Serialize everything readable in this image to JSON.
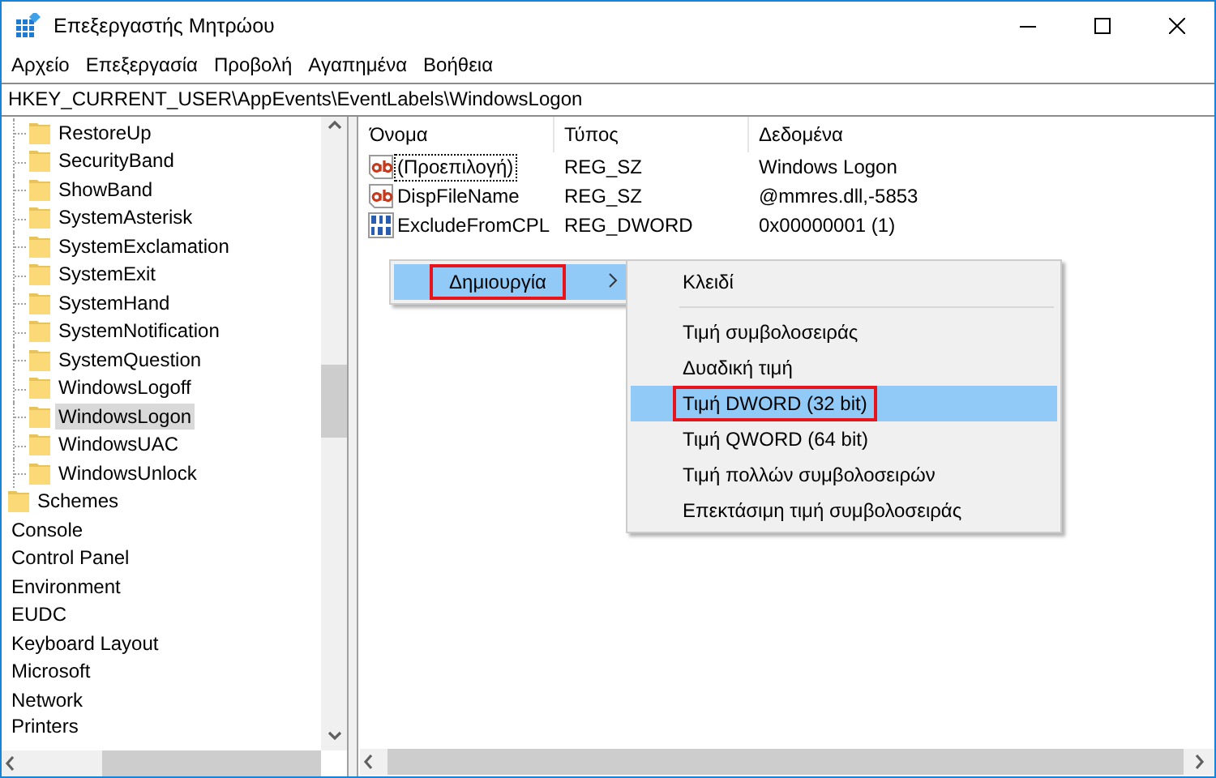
{
  "window": {
    "title": "Επεξεργαστής Μητρώου"
  },
  "menu_bar": [
    {
      "label": "Αρχείο"
    },
    {
      "label": "Επεξεργασία"
    },
    {
      "label": "Προβολή"
    },
    {
      "label": "Αγαπημένα"
    },
    {
      "label": "Βοήθεια"
    }
  ],
  "address": "HKEY_CURRENT_USER\\AppEvents\\EventLabels\\WindowsLogon",
  "tree": {
    "branch_children": [
      {
        "label": "RestoreUp",
        "selected": false
      },
      {
        "label": "SecurityBand",
        "selected": false
      },
      {
        "label": "ShowBand",
        "selected": false
      },
      {
        "label": "SystemAsterisk",
        "selected": false
      },
      {
        "label": "SystemExclamation",
        "selected": false
      },
      {
        "label": "SystemExit",
        "selected": false
      },
      {
        "label": "SystemHand",
        "selected": false
      },
      {
        "label": "SystemNotification",
        "selected": false
      },
      {
        "label": "SystemQuestion",
        "selected": false
      },
      {
        "label": "WindowsLogoff",
        "selected": false
      },
      {
        "label": "WindowsLogon",
        "selected": true
      },
      {
        "label": "WindowsUAC",
        "selected": false
      },
      {
        "label": "WindowsUnlock",
        "selected": false
      }
    ],
    "items": [
      {
        "label": "Schemes",
        "kind": "folder",
        "selected": false
      },
      {
        "label": "Console",
        "kind": "plain",
        "selected": false
      },
      {
        "label": "Control Panel",
        "kind": "plain",
        "selected": false
      },
      {
        "label": "Environment",
        "kind": "plain",
        "selected": false
      },
      {
        "label": "EUDC",
        "kind": "plain",
        "selected": false
      },
      {
        "label": "Keyboard Layout",
        "kind": "plain",
        "selected": false
      },
      {
        "label": "Microsoft",
        "kind": "plain",
        "selected": false
      },
      {
        "label": "Network",
        "kind": "plain",
        "selected": false
      },
      {
        "label": "Printers",
        "kind": "plain",
        "selected": false
      }
    ]
  },
  "values": {
    "columns": [
      "Όνομα",
      "Τύπος",
      "Δεδομένα"
    ],
    "rows": [
      {
        "name": "(Προεπιλογή)",
        "type": "REG_SZ",
        "data": "Windows Logon",
        "kind": "string",
        "focused": true
      },
      {
        "name": "DispFileName",
        "type": "REG_SZ",
        "data": "@mmres.dll,-5853",
        "kind": "string",
        "focused": false
      },
      {
        "name": "ExcludeFromCPL",
        "type": "REG_DWORD",
        "data": "0x00000001 (1)",
        "kind": "dword",
        "focused": false
      }
    ]
  },
  "context_menu": {
    "items": [
      {
        "label": "Δημιουργία",
        "selected": true,
        "outlined": true,
        "submenu": true
      }
    ]
  },
  "submenu": {
    "items": [
      {
        "kind": "item",
        "label": "Κλειδί",
        "selected": false,
        "outlined": false
      },
      {
        "kind": "separator"
      },
      {
        "kind": "item",
        "label": "Τιμή συμβολοσειράς",
        "selected": false,
        "outlined": false
      },
      {
        "kind": "item",
        "label": "Δυαδική τιμή",
        "selected": false,
        "outlined": false
      },
      {
        "kind": "item",
        "label": "Τιμή DWORD (32 bit)",
        "selected": true,
        "outlined": true
      },
      {
        "kind": "item",
        "label": "Τιμή QWORD (64 bit)",
        "selected": false,
        "outlined": false
      },
      {
        "kind": "item",
        "label": "Τιμή πολλών συμβολοσειρών",
        "selected": false,
        "outlined": false
      },
      {
        "kind": "item",
        "label": "Επεκτάσιμη τιμή συμβολοσειράς",
        "selected": false,
        "outlined": false
      }
    ]
  }
}
